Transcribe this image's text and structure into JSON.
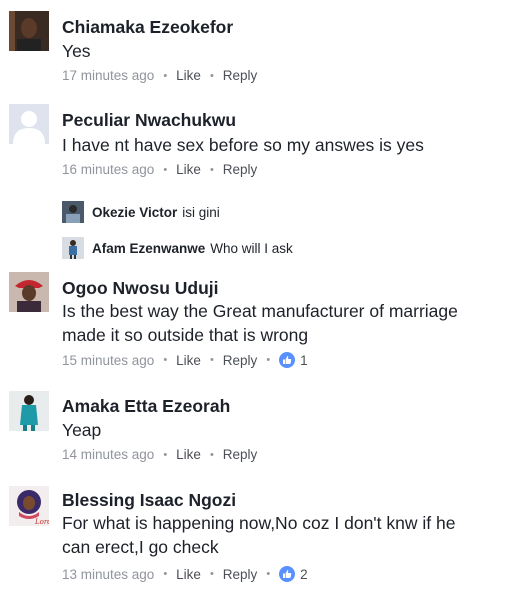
{
  "actions": {
    "like": "Like",
    "reply": "Reply",
    "dot": "•"
  },
  "comments": [
    {
      "name": "Chiamaka Ezeokefor",
      "lines": [
        "Yes"
      ],
      "time": "17 minutes ago"
    },
    {
      "name": "Peculiar Nwachukwu",
      "lines": [
        "I have nt have sex before so my answes is yes"
      ],
      "time": "16 minutes ago",
      "replies": [
        {
          "name": "Okezie Victor",
          "text": "isi gini"
        },
        {
          "name": "Afam Ezenwanwe",
          "text": "Who will I ask"
        }
      ]
    },
    {
      "name": "Ogoo Nwosu Uduji",
      "lines": [
        "Is the best way the Great manufacturer of marriage",
        "made it so outside that is wrong"
      ],
      "time": "15 minutes ago",
      "likes": "1"
    },
    {
      "name": "Amaka Etta Ezeorah",
      "lines": [
        "Yeap"
      ],
      "time": "14 minutes ago"
    },
    {
      "name": "Blessing Isaac Ngozi",
      "lines": [
        "For what is happening now,No coz  I don't knw if he",
        "can erect,I go check"
      ],
      "time": "13 minutes ago",
      "likes": "2",
      "avatar_caption": "Lord"
    }
  ],
  "colors": {
    "name": "#1d2129",
    "meta": "#90949c",
    "link": "#4b4f56",
    "like_badge": "#5890ff"
  }
}
